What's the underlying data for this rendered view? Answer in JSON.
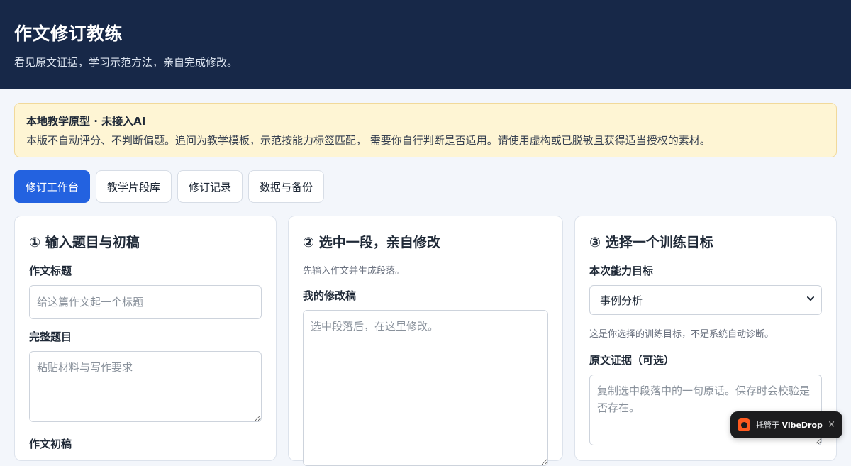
{
  "header": {
    "title": "作文修订教练",
    "subtitle": "看见原文证据，学习示范方法，亲自完成修改。"
  },
  "notice": {
    "title": "本地教学原型 · 未接入AI",
    "body": "本版不自动评分、不判断偏题。追问为教学模板，示范按能力标签匹配， 需要你自行判断是否适用。请使用虚构或已脱敏且获得适当授权的素材。"
  },
  "tabs": [
    {
      "label": "修订工作台",
      "active": true
    },
    {
      "label": "教学片段库",
      "active": false
    },
    {
      "label": "修订记录",
      "active": false
    },
    {
      "label": "数据与备份",
      "active": false
    }
  ],
  "step1": {
    "heading": "① 输入题目与初稿",
    "title_label": "作文标题",
    "title_placeholder": "给这篇作文起一个标题",
    "prompt_label": "完整题目",
    "prompt_placeholder": "粘贴材料与写作要求",
    "draft_label": "作文初稿"
  },
  "step2": {
    "heading": "② 选中一段，亲自修改",
    "hint": "先输入作文并生成段落。",
    "revision_label": "我的修改稿",
    "revision_placeholder": "选中段落后，在这里修改。"
  },
  "step3": {
    "heading": "③ 选择一个训练目标",
    "goal_label": "本次能力目标",
    "goal_value": "事例分析",
    "goal_hint": "这是你选择的训练目标，不是系统自动诊断。",
    "evidence_label": "原文证据（可选）",
    "evidence_placeholder": "复制选中段落中的一句原话。保存时会校验是否存在。"
  },
  "badge": {
    "prefix": "托管于",
    "brand": "VibeDrop",
    "close": "×",
    "logo_icon": "vibedrop-logo-icon",
    "close_icon": "close-icon"
  },
  "colors": {
    "header_bg": "#172848",
    "accent": "#2362e0",
    "notice_bg": "#fef5d4",
    "page_bg": "#f3f6fb"
  }
}
